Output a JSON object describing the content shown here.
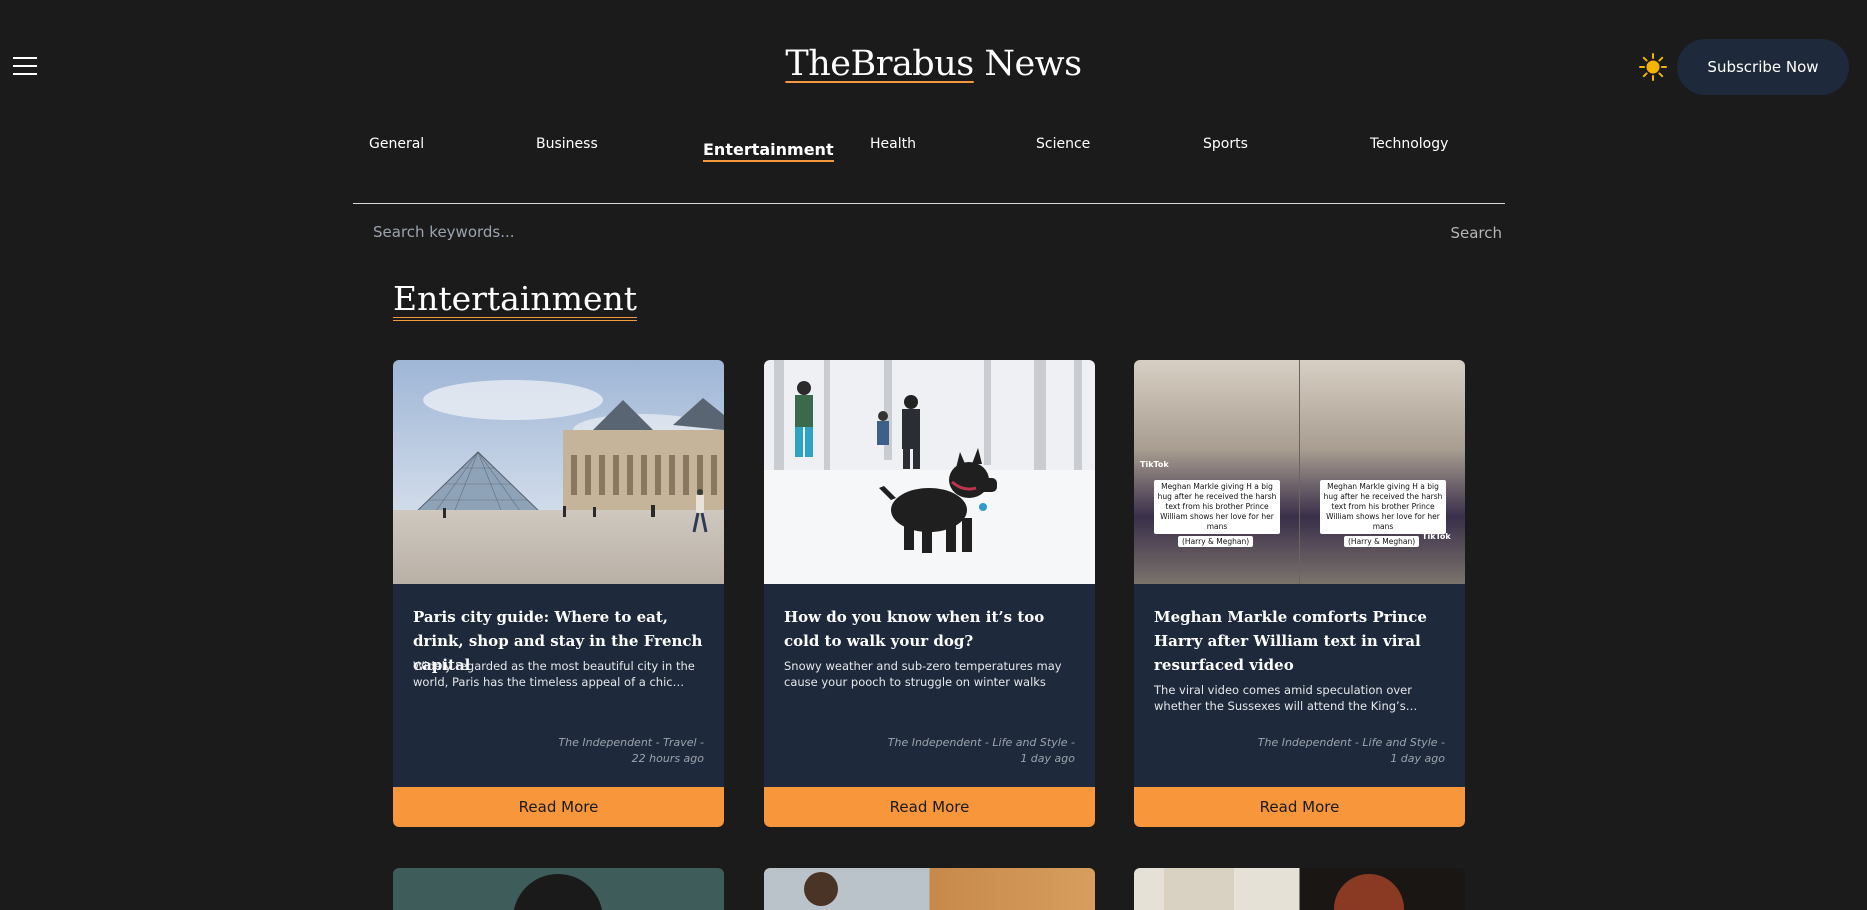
{
  "header": {
    "title_brand": "TheBrabus",
    "title_rest": " News",
    "subscribe_label": "Subscribe Now",
    "menu_icon": "hamburger-icon",
    "theme_icon": "sun-icon"
  },
  "nav": {
    "items": [
      {
        "label": "General"
      },
      {
        "label": "Business"
      },
      {
        "label": "Entertainment",
        "active": true
      },
      {
        "label": "Health"
      },
      {
        "label": "Science"
      },
      {
        "label": "Sports"
      },
      {
        "label": "Technology"
      }
    ]
  },
  "search": {
    "placeholder": "Search keywords...",
    "button_label": "Search"
  },
  "section": {
    "heading": "Entertainment"
  },
  "articles": [
    {
      "title": "Paris city guide: Where to eat, drink, shop and stay in the French capital",
      "description": "Widely regarded as the most beautiful city in the world, Paris has the timeless appeal of a chic trench coat and a good novel",
      "source": "The Independent - Travel -",
      "time": "22 hours ago",
      "read_more": "Read More"
    },
    {
      "title": "How do you know when it’s too cold to walk your dog?",
      "description": "Snowy weather and sub-zero temperatures may cause your pooch to struggle on winter walks",
      "source": "The Independent - Life and Style -",
      "time": "1 day ago",
      "read_more": "Read More"
    },
    {
      "title": "Meghan Markle comforts Prince Harry after William text in viral resurfaced video",
      "description": "The viral video comes amid speculation over whether the Sussexes will attend the King’s coronation",
      "source": "The Independent - Life and Style -",
      "time": "1 day ago",
      "read_more": "Read More",
      "image_caption": "Meghan Markle giving H a big hug after he received the harsh text from his brother Prince William shows her love for her mans",
      "image_tag": "(Harry & Meghan)",
      "image_brand": "TikTok"
    }
  ],
  "colors": {
    "background": "#1b1b1c",
    "card": "#1e293b",
    "accent": "#f7963a",
    "subscribe_bg": "#1e293b"
  }
}
